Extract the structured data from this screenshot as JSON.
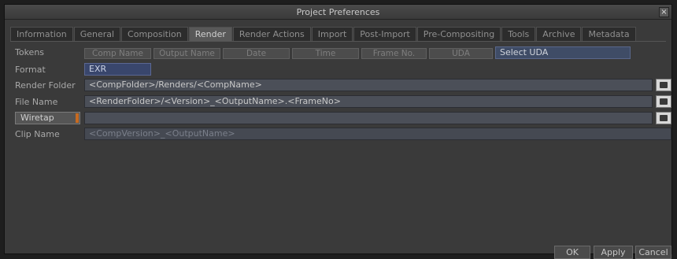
{
  "window": {
    "title": "Project Preferences",
    "close_glyph": "×"
  },
  "tabs": [
    {
      "label": "Information"
    },
    {
      "label": "General"
    },
    {
      "label": "Composition"
    },
    {
      "label": "Render",
      "active": true
    },
    {
      "label": "Render Actions"
    },
    {
      "label": "Import"
    },
    {
      "label": "Post-Import"
    },
    {
      "label": "Pre-Compositing"
    },
    {
      "label": "Tools"
    },
    {
      "label": "Archive"
    },
    {
      "label": "Metadata"
    }
  ],
  "tokens": {
    "label": "Tokens",
    "buttons": [
      "Comp Name",
      "Output Name",
      "Date",
      "Time",
      "Frame No.",
      "UDA"
    ],
    "select_uda": "Select UDA"
  },
  "format": {
    "label": "Format",
    "value": "EXR"
  },
  "render_folder": {
    "label": "Render Folder",
    "value": "<CompFolder>/Renders/<CompName>"
  },
  "file_name": {
    "label": "File Name",
    "value": "<RenderFolder>/<Version>_<OutputName>.<FrameNo>"
  },
  "wiretap": {
    "label": "Wiretap",
    "value": ""
  },
  "clip_name": {
    "label": "Clip Name",
    "value": "<CompVersion>_<OutputName>"
  },
  "buttons": {
    "ok": "OK",
    "apply": "Apply",
    "cancel": "Cancel"
  },
  "colors": {
    "accent": "#c76a20",
    "selection": "#3f4c66"
  },
  "icons": {
    "browse": "folder-browse-icon",
    "close": "close-icon"
  }
}
